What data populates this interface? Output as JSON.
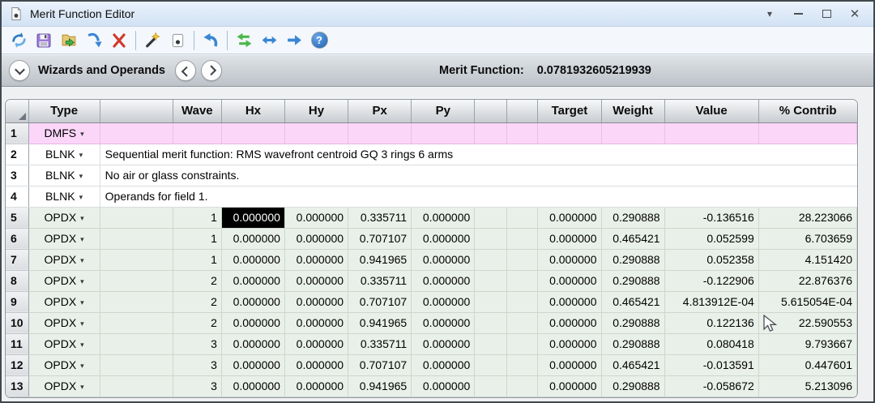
{
  "window": {
    "title": "Merit Function Editor"
  },
  "toolbar": {
    "icons": [
      "update-icon",
      "save-icon",
      "open-icon",
      "insert-operand-icon",
      "delete-operand-icon",
      "wizard-icon",
      "properties-icon",
      "undo-icon",
      "swap-rows-icon",
      "resize-columns-icon",
      "goto-operand-icon",
      "help-icon"
    ]
  },
  "navbar": {
    "title": "Wizards and Operands",
    "merit_function_label": "Merit Function:",
    "merit_function_value": "0.0781932605219939"
  },
  "table": {
    "headers": {
      "type": "Type",
      "wave": "Wave",
      "hx": "Hx",
      "hy": "Hy",
      "px": "Px",
      "py": "Py",
      "target": "Target",
      "weight": "Weight",
      "value": "Value",
      "contrib": "% Contrib"
    },
    "selected_cell": {
      "row": "5",
      "column": "Hx"
    },
    "rows": [
      {
        "num": "1",
        "type": "DMFS"
      },
      {
        "num": "2",
        "type": "BLNK",
        "comment": "Sequential merit function: RMS wavefront centroid GQ 3 rings 6 arms"
      },
      {
        "num": "3",
        "type": "BLNK",
        "comment": "No air or glass constraints."
      },
      {
        "num": "4",
        "type": "BLNK",
        "comment": "Operands for field 1."
      },
      {
        "num": "5",
        "type": "OPDX",
        "wave": "1",
        "hx": "0.000000",
        "hy": "0.000000",
        "px": "0.335711",
        "py": "0.000000",
        "target": "0.000000",
        "weight": "0.290888",
        "value": "-0.136516",
        "contrib": "28.223066"
      },
      {
        "num": "6",
        "type": "OPDX",
        "wave": "1",
        "hx": "0.000000",
        "hy": "0.000000",
        "px": "0.707107",
        "py": "0.000000",
        "target": "0.000000",
        "weight": "0.465421",
        "value": "0.052599",
        "contrib": "6.703659"
      },
      {
        "num": "7",
        "type": "OPDX",
        "wave": "1",
        "hx": "0.000000",
        "hy": "0.000000",
        "px": "0.941965",
        "py": "0.000000",
        "target": "0.000000",
        "weight": "0.290888",
        "value": "0.052358",
        "contrib": "4.151420"
      },
      {
        "num": "8",
        "type": "OPDX",
        "wave": "2",
        "hx": "0.000000",
        "hy": "0.000000",
        "px": "0.335711",
        "py": "0.000000",
        "target": "0.000000",
        "weight": "0.290888",
        "value": "-0.122906",
        "contrib": "22.876376"
      },
      {
        "num": "9",
        "type": "OPDX",
        "wave": "2",
        "hx": "0.000000",
        "hy": "0.000000",
        "px": "0.707107",
        "py": "0.000000",
        "target": "0.000000",
        "weight": "0.465421",
        "value": "4.813912E-04",
        "contrib": "5.615054E-04"
      },
      {
        "num": "10",
        "type": "OPDX",
        "wave": "2",
        "hx": "0.000000",
        "hy": "0.000000",
        "px": "0.941965",
        "py": "0.000000",
        "target": "0.000000",
        "weight": "0.290888",
        "value": "0.122136",
        "contrib": "22.590553"
      },
      {
        "num": "11",
        "type": "OPDX",
        "wave": "3",
        "hx": "0.000000",
        "hy": "0.000000",
        "px": "0.335711",
        "py": "0.000000",
        "target": "0.000000",
        "weight": "0.290888",
        "value": "0.080418",
        "contrib": "9.793667"
      },
      {
        "num": "12",
        "type": "OPDX",
        "wave": "3",
        "hx": "0.000000",
        "hy": "0.000000",
        "px": "0.707107",
        "py": "0.000000",
        "target": "0.000000",
        "weight": "0.465421",
        "value": "-0.013591",
        "contrib": "0.447601"
      },
      {
        "num": "13",
        "type": "OPDX",
        "wave": "3",
        "hx": "0.000000",
        "hy": "0.000000",
        "px": "0.941965",
        "py": "0.000000",
        "target": "0.000000",
        "weight": "0.290888",
        "value": "-0.058672",
        "contrib": "5.213096"
      }
    ]
  },
  "colors": {
    "titlebar_bg": "#dce8f8",
    "dmfs_row_bg": "#fbd6f9",
    "data_row_bg": "#e9f0e9",
    "selected_cell_bg": "#000000",
    "selected_cell_text": "#ffffff",
    "accent_blue": "#3b86d4"
  }
}
